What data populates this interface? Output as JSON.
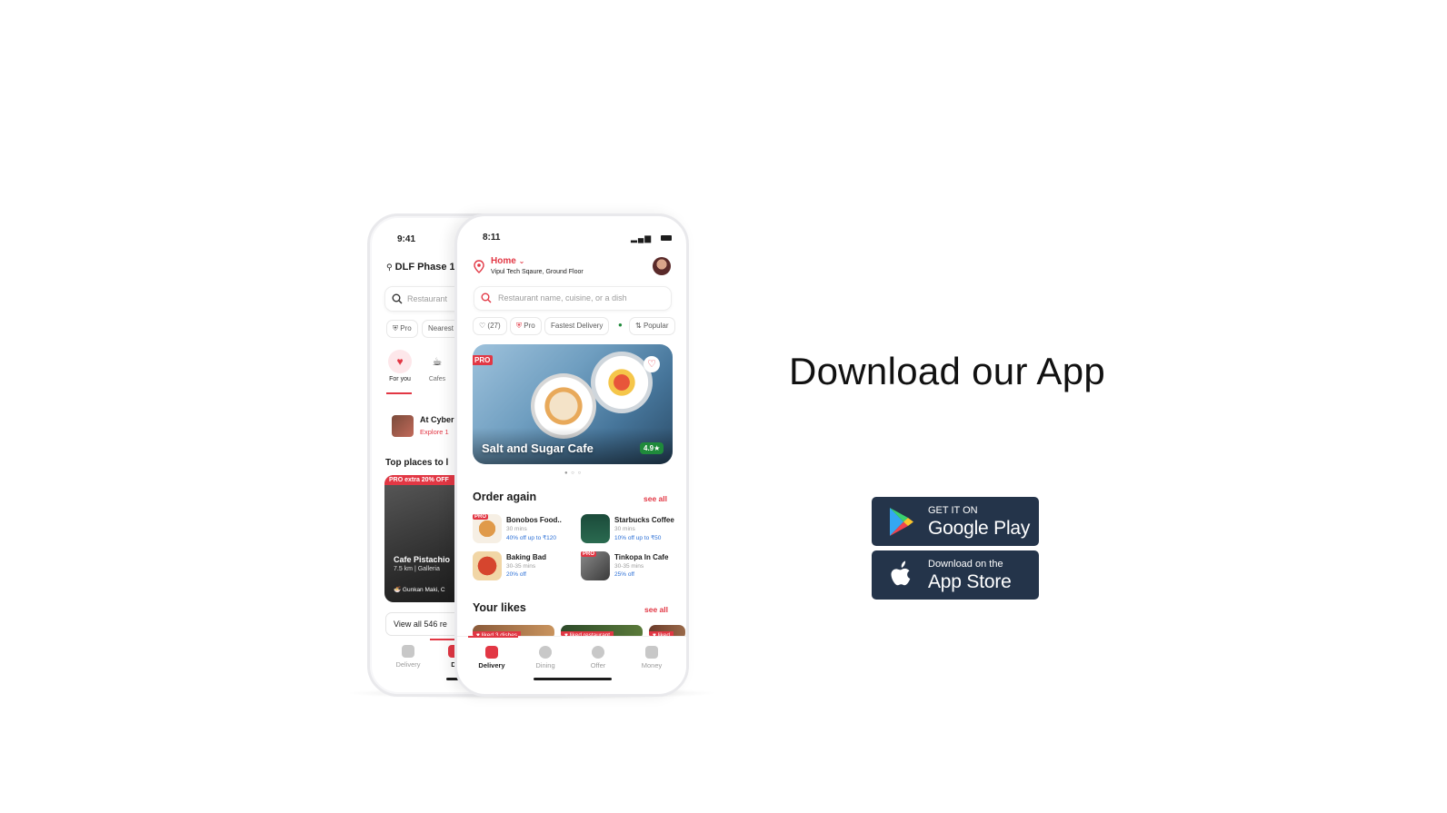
{
  "headline": "Download our App",
  "stores": {
    "google_play": {
      "small": "GET IT ON",
      "big": "Google Play"
    },
    "app_store": {
      "small": "Download on the",
      "big": "App Store"
    }
  },
  "back_phone": {
    "time": "9:41",
    "location": "DLF Phase 1,",
    "search_placeholder": "Restaurant",
    "chips": [
      "Pro",
      "Nearest"
    ],
    "categories": [
      "For you",
      "Cafes"
    ],
    "banner_title": "At Cyber",
    "banner_sub": "Explore 1",
    "section_title": "Top places to l",
    "card_tag": "PRO extra 20% OFF",
    "card_title": "Cafe Pistachio",
    "card_sub": "7.5 km | Galleria",
    "card_dish": "Gunkan Maki, C",
    "view_all": "View all 546 re",
    "nav": [
      "Delivery",
      "Di"
    ]
  },
  "front_phone": {
    "time": "8:11",
    "location_title": "Home",
    "location_sub": "Vipul Tech Sqaure, Ground Floor",
    "search_placeholder": "Restaurant name, cuisine, or a dish",
    "chips": [
      "(27)",
      "Pro",
      "Fastest Delivery",
      "Popular"
    ],
    "hero": {
      "tag": "PRO",
      "title": "Salt and Sugar Cafe",
      "rating": "4.9★"
    },
    "order_again": {
      "title": "Order again",
      "see_all": "see all",
      "items": [
        {
          "name": "Bonobos Food..",
          "time": "30 mins",
          "offer": "40% off up to ₹120",
          "pro": true
        },
        {
          "name": "Starbucks Coffee",
          "time": "30 mins",
          "offer": "10% off up to ₹50",
          "pro": false
        },
        {
          "name": "Baking Bad",
          "time": "30-35 mins",
          "offer": "20% off",
          "pro": false
        },
        {
          "name": "Tinkopa In Cafe",
          "time": "30-35 mins",
          "offer": "25% off",
          "pro": true
        }
      ]
    },
    "your_likes": {
      "title": "Your likes",
      "see_all": "see all",
      "tags": [
        "liked 3 dishes",
        "liked restaurant",
        "liked"
      ]
    },
    "nav": [
      "Delivery",
      "Dining",
      "Offer",
      "Money"
    ]
  },
  "colors": {
    "brand": "#e23744",
    "store_button": "#24344a",
    "rating": "#1f8a3b"
  }
}
